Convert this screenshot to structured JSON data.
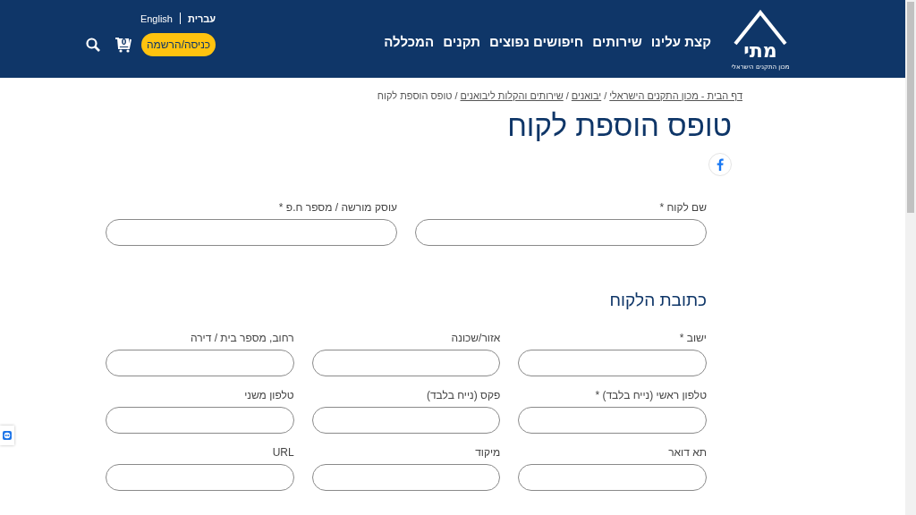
{
  "header": {
    "languages": [
      {
        "label": "עברית",
        "selected": true
      },
      {
        "label": "English",
        "selected": false
      }
    ],
    "login_button": "כניסה/הרשמה",
    "cart_count": "0",
    "nav": [
      "קצת עלינו",
      "שירותים",
      "חיפושים נפוצים",
      "תקנים",
      "המכללה"
    ],
    "logo": {
      "mark": "מתי",
      "tagline": "מכון התקנים הישראלי"
    }
  },
  "breadcrumb_separator": "/",
  "breadcrumb": [
    {
      "label": "דף הבית - מכון התקנים הישראלי",
      "kind": "link"
    },
    {
      "label": "יבואנים",
      "kind": "link"
    },
    {
      "label": "שירותים והקלות ליבואנים",
      "kind": "link"
    },
    {
      "label": "טופס הוספת לקוח",
      "kind": "current"
    }
  ],
  "title": "טופס הוספת לקוח",
  "customer_fields": [
    {
      "label": "שם לקוח *"
    },
    {
      "label": "עוסק מורשה / מספר ח.פ *"
    }
  ],
  "address_section": {
    "heading": "כתובת הלקוח",
    "fields": [
      {
        "label": "ישוב *"
      },
      {
        "label": "אזור/שכונה"
      },
      {
        "label": "רחוב, מספר בית / דירה"
      },
      {
        "label": "טלפון ראשי (נייח בלבד) *"
      },
      {
        "label": "פקס (נייח בלבד)"
      },
      {
        "label": "טלפון משני"
      },
      {
        "label": "תא דואר"
      },
      {
        "label": "מיקוד"
      },
      {
        "label": "URL"
      }
    ]
  }
}
